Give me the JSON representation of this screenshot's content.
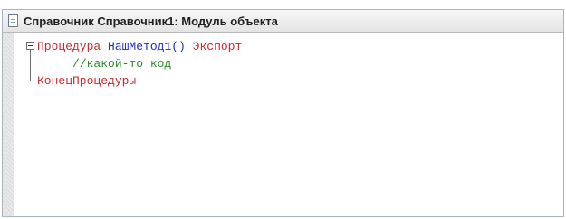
{
  "window": {
    "title": "Справочник Справочник1: Модуль объекта"
  },
  "code": {
    "line1": {
      "keyword": "Процедура",
      "name": "НашМетод1()",
      "export": "Экспорт"
    },
    "line2": {
      "comment": "//какой-то код"
    },
    "line3": {
      "keyword": "КонецПроцедуры"
    }
  },
  "colors": {
    "keyword": "#c22d2d",
    "identifier": "#1d2fb2",
    "comment": "#2b8b2b"
  }
}
